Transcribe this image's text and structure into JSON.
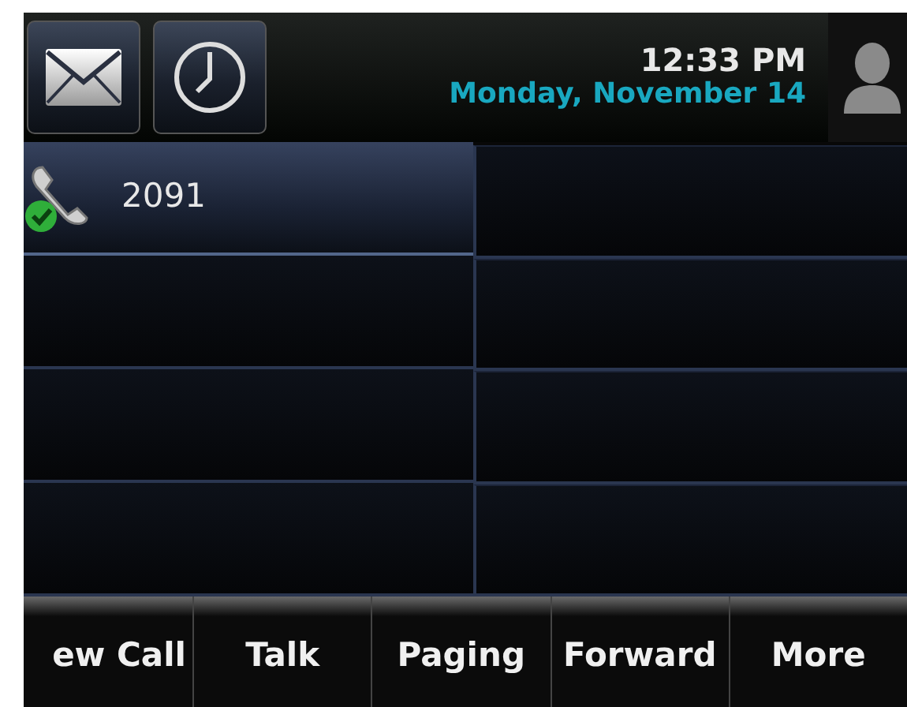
{
  "header": {
    "time": "12:33 PM",
    "date": "Monday, November 14"
  },
  "line_keys": [
    {
      "label": "2091",
      "selected": true,
      "registered": true
    }
  ],
  "softkeys": [
    "ew Call",
    "Talk",
    "Paging",
    "Forward",
    "More"
  ]
}
